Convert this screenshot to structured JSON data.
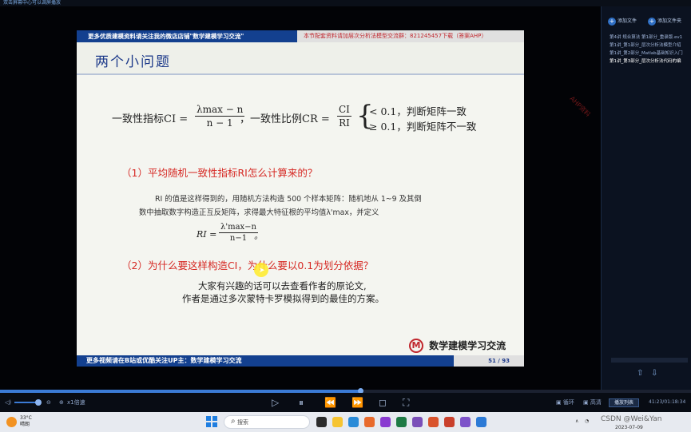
{
  "player": {
    "title": "双击屏幕中心可以调屏播放",
    "playlist": {
      "add_file": "添加文件",
      "add_folder": "添加文件夹",
      "items": [
        "第4讲 规合算法 第1部分_重录版.ev1",
        "第1讲_第1部分_层次分析法模型介绍",
        "第1讲_第2部分_Matlab基础知识入门",
        "第1讲_第3部分_层次分析法代码的编"
      ],
      "active_index": 3
    },
    "controls": {
      "speed": "x1倍速",
      "loop": "循环",
      "quality": "高清",
      "list": "播放列表",
      "time": "41:23/01:18:34"
    },
    "progress": 0.6
  },
  "slide": {
    "top_left": "更多优质建模资料请关注我的微店店铺\"数学建模学习交流\"",
    "top_right": "本节配套资料请加层次分析法模型交流群：821245457下载（答案AHP）",
    "title": "两个小问题",
    "formula": {
      "ci_label": "一致性指标CI =",
      "ci_num": "λmax − n",
      "ci_den": "n − 1",
      "cr_label": "，一致性比例CR =",
      "cr_num": "CI",
      "cr_den": "RI",
      "case1": "< 0.1，判断矩阵一致",
      "case2": "≥ 0.1，判断矩阵不一致"
    },
    "q1": "（1）平均随机一致性指标RI怎么计算来的？",
    "ri_line1": "RI 的值是这样得到的，用随机方法构造 500 个样本矩阵：随机地从 1~9 及其倒",
    "ri_line2": "数中抽取数字构造正互反矩阵，求得最大特征根的平均值λ'max，并定义",
    "ri_eq_label": "RI =",
    "ri_eq_num": "λ'max−n",
    "ri_eq_den": "n−1",
    "ri_eq_end": "。",
    "q2": "（2）为什么要这样构造CI，为什么要以0.1为划分依据？",
    "closing1": "大家有兴趣的话可以去查看作者的原论文,",
    "closing2": "作者是通过多次蒙特卡罗模拟得到的最佳的方案。",
    "logo_text": "数学建模学习交流",
    "bottom_left": "更多视频请在B站或优酷关注UP主：数学建模学习交流",
    "page": "51 / 93",
    "watermark": "AHP资料"
  },
  "taskbar": {
    "temp": "33°C",
    "weather": "晴朗",
    "search": "搜索",
    "csdn": "CSDN @Wei&Yan",
    "date": "2023-07-09"
  }
}
